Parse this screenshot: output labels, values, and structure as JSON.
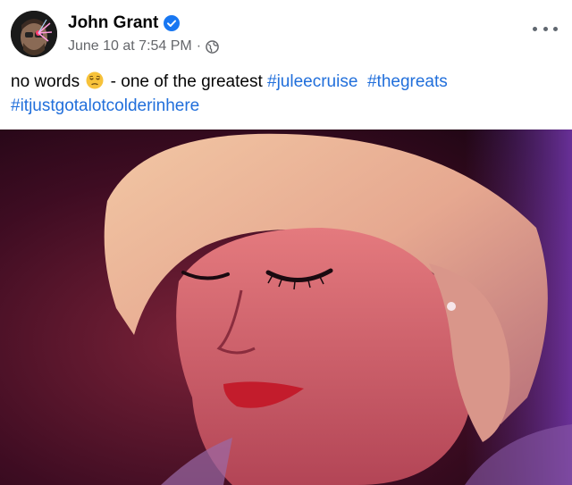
{
  "post": {
    "author": {
      "name": "John Grant",
      "verified": true
    },
    "timestamp": "June 10 at 7:54 PM",
    "separator": "·",
    "audience_icon": "globe-icon",
    "more_icon": "more-options-icon",
    "text": {
      "prefix": "no words",
      "emoji": "pensive-face-emoji",
      "middle": "- one of the greatest",
      "hashtags": [
        "#juleecruise",
        "#thegreats",
        "#itjustgotalotcolderinhere"
      ]
    }
  },
  "colors": {
    "link": "#216fdb",
    "verified_badge": "#1877f2",
    "meta": "#65676b",
    "video_background": "#4a0f24"
  }
}
